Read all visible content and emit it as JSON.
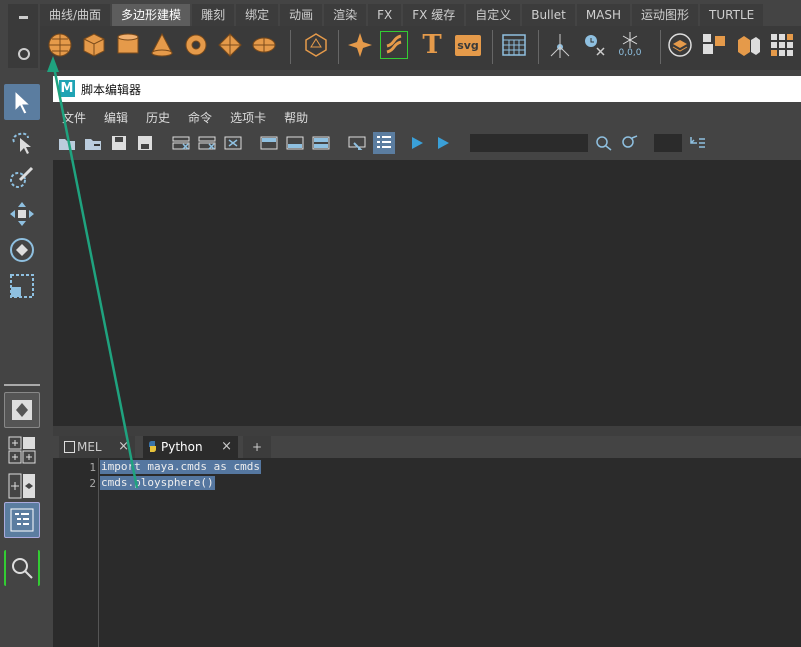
{
  "shelf": {
    "tabs": [
      "曲线/曲面",
      "多边形建模",
      "雕刻",
      "绑定",
      "动画",
      "渲染",
      "FX",
      "FX 缓存",
      "自定义",
      "Bullet",
      "MASH",
      "运动图形",
      "TURTLE"
    ],
    "active_tab": "多边形建模",
    "icons": [
      "poly-sphere-icon",
      "poly-cube-icon",
      "poly-cylinder-icon",
      "poly-cone-icon",
      "poly-torus-icon",
      "poly-plane-icon",
      "poly-disc-icon",
      "platonic-solid-icon",
      "super-shape-icon",
      "sweep-mesh-icon",
      "type-tool-icon",
      "svg-tool-icon",
      "poly-grid-icon",
      "center-pivot-icon",
      "freeze-transform-icon",
      "snowflake-icon",
      "combine-icon",
      "separate-icon",
      "extract-icon",
      "smooth-icon"
    ],
    "svg_label": "svg",
    "type_label": "T",
    "coord_label": "0,0,0"
  },
  "window": {
    "title": "脚本编辑器",
    "logo": "M"
  },
  "menu": [
    "文件",
    "编辑",
    "历史",
    "命令",
    "选项卡",
    "帮助"
  ],
  "editor_tabs": [
    {
      "label": "MEL",
      "close": "×"
    },
    {
      "label": "Python",
      "close": "×"
    },
    {
      "label": "+"
    }
  ],
  "code": {
    "lines": [
      "import maya.cmds as cmds",
      "cmds.ploysphere()"
    ],
    "line_numbers": [
      "1",
      "2"
    ]
  },
  "colors": {
    "accent_arrow": "#1fa37f",
    "shelf_icon": "#e59a4a",
    "selection": "#5577a0"
  }
}
